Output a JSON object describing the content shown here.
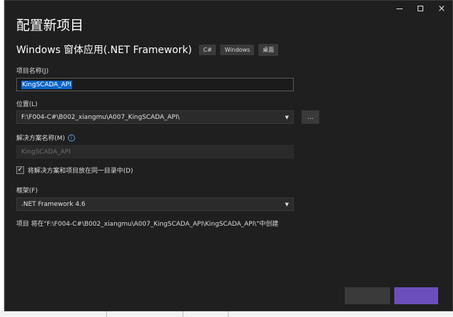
{
  "dialog": {
    "title": "配置新项目",
    "template_name": "Windows 窗体应用(.NET Framework)",
    "tags": [
      "C#",
      "Windows",
      "桌面"
    ]
  },
  "window_controls": {
    "minimize": "minimize",
    "maximize": "maximize",
    "close": "×"
  },
  "project_name": {
    "label": "项目名称(J)",
    "value": "KingSCADA_API"
  },
  "location": {
    "label": "位置(L)",
    "value": "F:\\F004-C#\\B002_xiangmu\\A007_KingSCADA_API\\",
    "browse_label": "..."
  },
  "solution_name": {
    "label": "解决方案名称(M)",
    "info_icon": "i",
    "value": "KingSCADA_API"
  },
  "same_dir_checkbox": {
    "checked": true,
    "check_glyph": "✓",
    "label": "将解决方案和项目放在同一目录中(D)"
  },
  "framework": {
    "label": "框架(F)",
    "value": ".NET Framework 4.6"
  },
  "summary_text": "项目 将在\"F:\\F004-C#\\B002_xiangmu\\A007_KingSCADA_API\\KingSCADA_API\\\"中创建",
  "colors": {
    "dialog_bg": "#1f1f1f",
    "accent": "#6b4fbb",
    "selection": "#0a64c8"
  }
}
